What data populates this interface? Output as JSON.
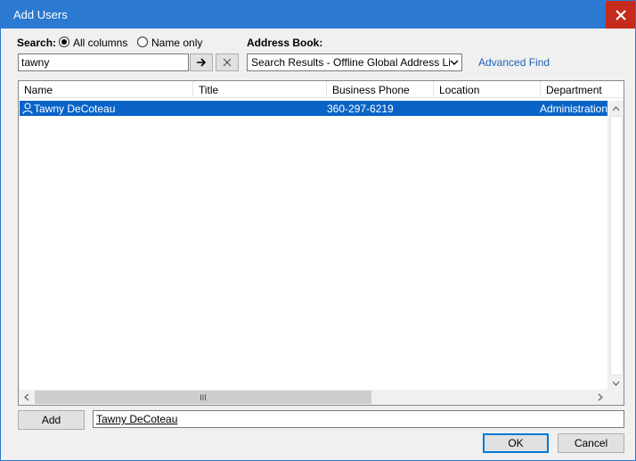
{
  "window": {
    "title": "Add Users",
    "close_label": "×"
  },
  "search": {
    "label": "Search:",
    "options": [
      "All columns",
      "Name only"
    ],
    "selected_option": "All columns",
    "value": "tawny",
    "go_icon": "arrow-right-icon",
    "clear_icon": "x-clear-icon"
  },
  "address_book": {
    "label": "Address Book:",
    "selected": "Search Results - Offline Global Address List",
    "advanced_find": "Advanced Find"
  },
  "table": {
    "columns": [
      "Name",
      "Title",
      "Business Phone",
      "Location",
      "Department"
    ],
    "rows": [
      {
        "name": "Tawny DeCoteau",
        "title": "",
        "business_phone": "360-297-6219",
        "location": "",
        "department": "Administration",
        "selected": true
      }
    ],
    "hscroll_grip": "III"
  },
  "footer": {
    "add_button": "Add",
    "added_value": "Tawny DeCoteau",
    "ok_button": "OK",
    "cancel_button": "Cancel"
  },
  "colors": {
    "titlebar": "#2b79d0",
    "selection": "#0a64c8",
    "link": "#1e63b8",
    "close": "#c42b1c"
  }
}
